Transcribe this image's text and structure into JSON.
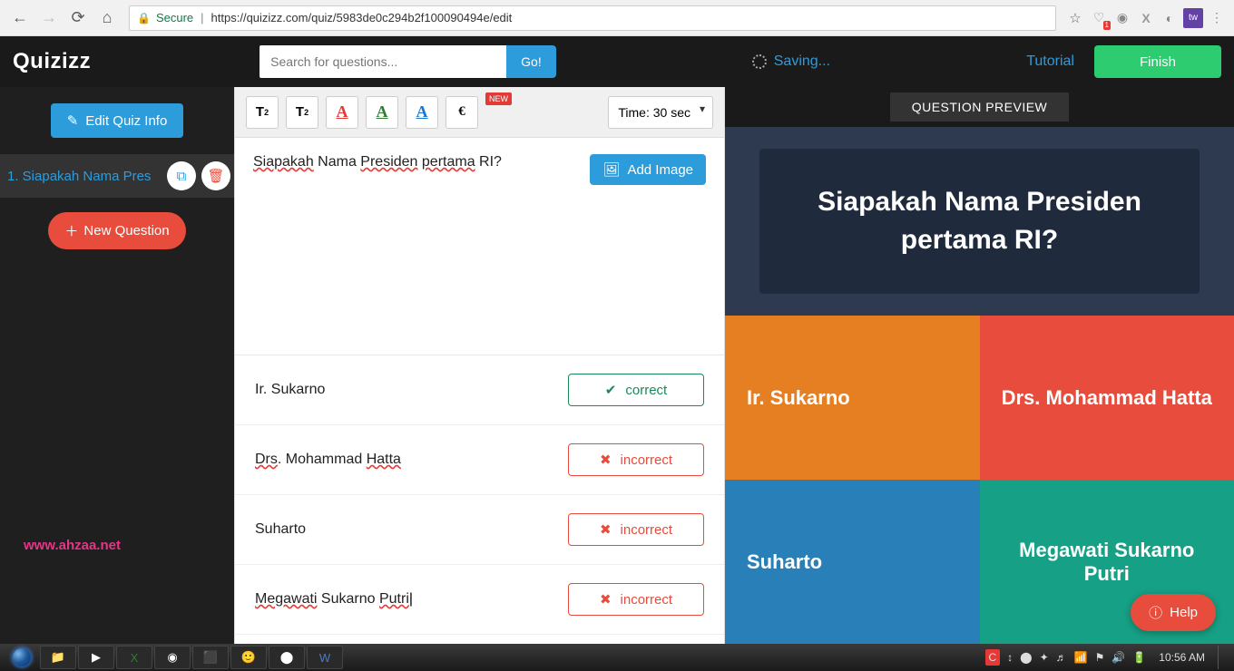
{
  "browser": {
    "secure_label": "Secure",
    "url": "https://quizizz.com/quiz/5983de0c294b2f100090494e/edit",
    "heart_badge": "1"
  },
  "nav": {
    "logo": "Quizizz",
    "search_placeholder": "Search for questions...",
    "go_label": "Go!",
    "saving_label": "Saving...",
    "tutorial_label": "Tutorial",
    "finish_label": "Finish"
  },
  "sidebar": {
    "edit_info_label": "Edit Quiz Info",
    "question_row": "1.  Siapakah Nama Pres",
    "new_question_label": "New Question",
    "watermark": "www.ahzaa.net"
  },
  "toolbar": {
    "t_sup": "T",
    "t_sub": "T",
    "euro": "€",
    "new_label": "NEW",
    "time_label": "Time: 30 sec"
  },
  "question": {
    "text_parts": [
      "Siapakah",
      " Nama ",
      "Presiden",
      " ",
      "pertama",
      " RI?"
    ],
    "add_image_label": "Add Image"
  },
  "answers": [
    {
      "text": "Ir. Sukarno",
      "status": "correct",
      "status_label": "correct"
    },
    {
      "text_parts": [
        "Drs",
        ". Mohammad ",
        "Hatta"
      ],
      "status": "incorrect",
      "status_label": "incorrect"
    },
    {
      "text": "Suharto",
      "status": "incorrect",
      "status_label": "incorrect"
    },
    {
      "text_parts": [
        "Megawati",
        " Sukarno ",
        "Putri"
      ],
      "status": "incorrect",
      "status_label": "incorrect",
      "caret": true
    }
  ],
  "preview": {
    "header": "QUESTION PREVIEW",
    "question": "Siapakah Nama Presiden pertama RI?",
    "opts": [
      "Ir. Sukarno",
      "Drs. Mohammad Hatta",
      "Suharto",
      "Megawati Sukarno Putri"
    ]
  },
  "help_label": "Help",
  "taskbar": {
    "clock": "10:56 AM"
  }
}
